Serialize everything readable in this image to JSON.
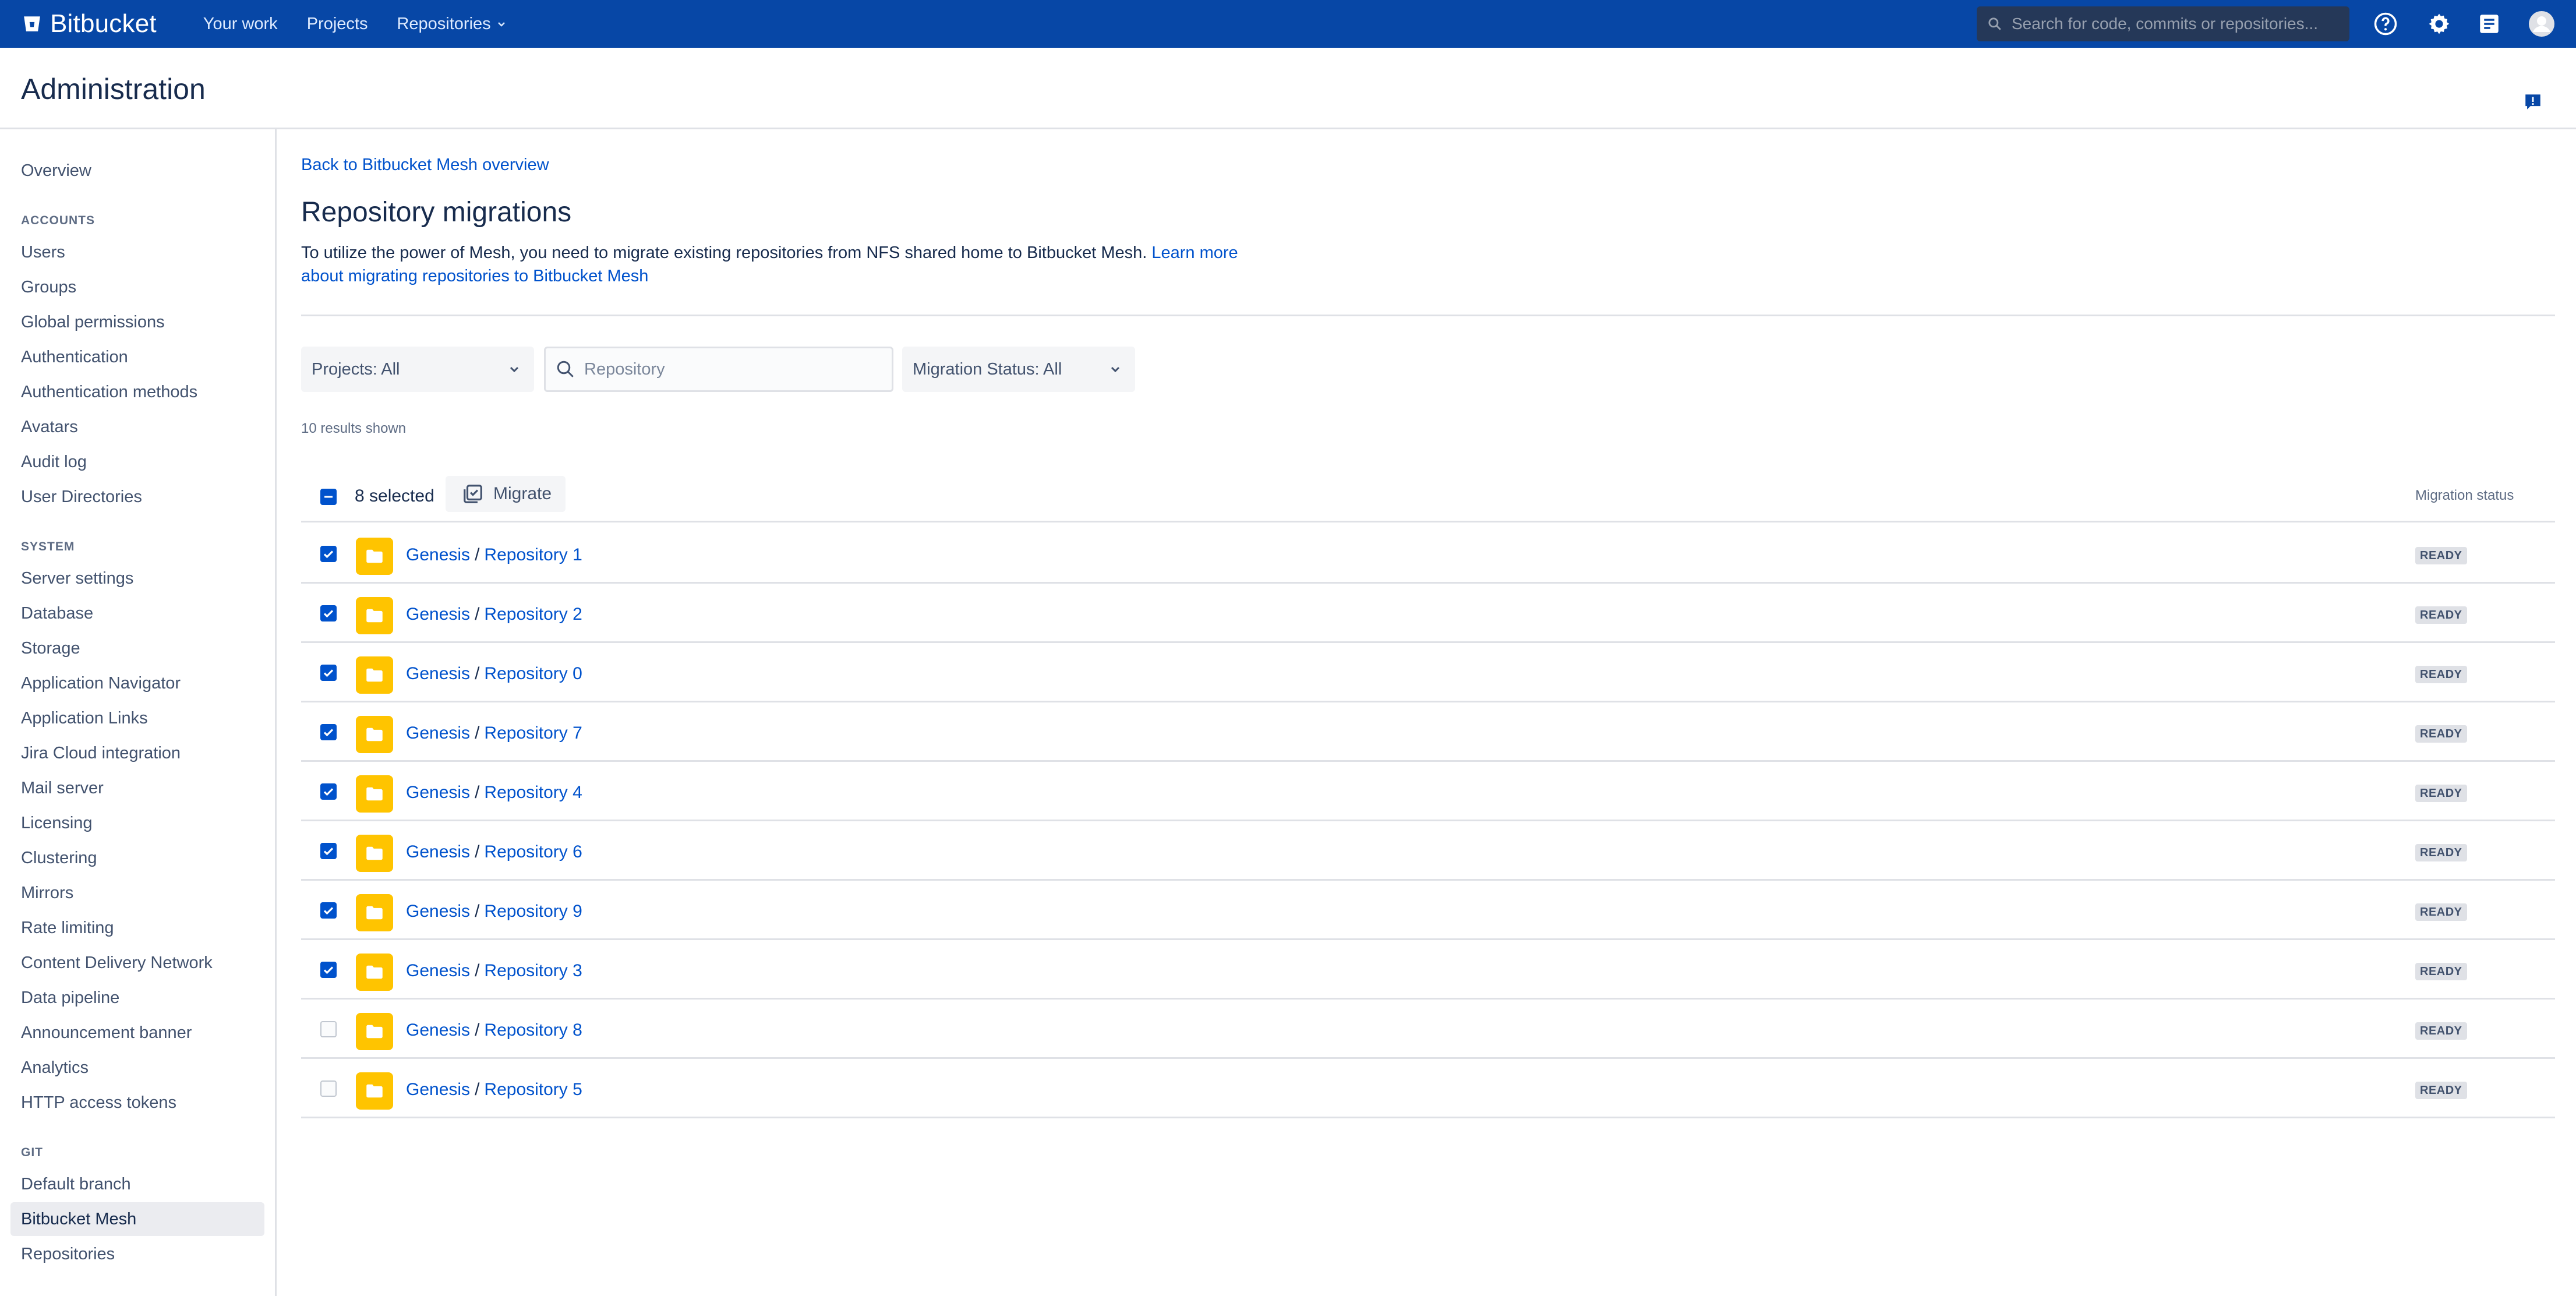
{
  "topbar": {
    "brand": "Bitbucket",
    "nav": [
      "Your work",
      "Projects",
      "Repositories"
    ],
    "search_placeholder": "Search for code, commits or repositories...",
    "icons": [
      "help-icon",
      "settings-icon",
      "notes-icon",
      "user-avatar"
    ],
    "colors": {
      "bar": "#0747a6",
      "search_bg": "#253858"
    }
  },
  "page": {
    "title": "Administration"
  },
  "sidebar": {
    "top": [
      {
        "label": "Overview"
      }
    ],
    "sections": [
      {
        "heading": "ACCOUNTS",
        "items": [
          "Users",
          "Groups",
          "Global permissions",
          "Authentication",
          "Authentication methods",
          "Avatars",
          "Audit log",
          "User Directories"
        ]
      },
      {
        "heading": "SYSTEM",
        "items": [
          "Server settings",
          "Database",
          "Storage",
          "Application Navigator",
          "Application Links",
          "Jira Cloud integration",
          "Mail server",
          "Licensing",
          "Clustering",
          "Mirrors",
          "Rate limiting",
          "Content Delivery Network",
          "Data pipeline",
          "Announcement banner",
          "Analytics",
          "HTTP access tokens"
        ]
      },
      {
        "heading": "GIT",
        "items": [
          "Default branch",
          "Bitbucket Mesh",
          "Repositories"
        ]
      }
    ],
    "active": "Bitbucket Mesh"
  },
  "main": {
    "back_link": "Back to Bitbucket Mesh overview",
    "heading": "Repository migrations",
    "intro_text": "To utilize the power of Mesh, you need to migrate existing repositories from NFS shared home to Bitbucket Mesh. ",
    "intro_link": "Learn more about migrating repositories to Bitbucket Mesh",
    "filters": {
      "projects": "Projects: All",
      "repository_placeholder": "Repository",
      "migration_status": "Migration Status: All"
    },
    "results_text": "10 results shown",
    "table": {
      "selected_label": "8 selected",
      "migrate_label": "Migrate",
      "status_header": "Migration status",
      "rows": [
        {
          "project": "Genesis",
          "repo": "Repository 1",
          "checked": true,
          "status": "READY"
        },
        {
          "project": "Genesis",
          "repo": "Repository 2",
          "checked": true,
          "status": "READY"
        },
        {
          "project": "Genesis",
          "repo": "Repository 0",
          "checked": true,
          "status": "READY"
        },
        {
          "project": "Genesis",
          "repo": "Repository 7",
          "checked": true,
          "status": "READY"
        },
        {
          "project": "Genesis",
          "repo": "Repository 4",
          "checked": true,
          "status": "READY"
        },
        {
          "project": "Genesis",
          "repo": "Repository 6",
          "checked": true,
          "status": "READY"
        },
        {
          "project": "Genesis",
          "repo": "Repository 9",
          "checked": true,
          "status": "READY"
        },
        {
          "project": "Genesis",
          "repo": "Repository 3",
          "checked": true,
          "status": "READY"
        },
        {
          "project": "Genesis",
          "repo": "Repository 8",
          "checked": false,
          "status": "READY"
        },
        {
          "project": "Genesis",
          "repo": "Repository 5",
          "checked": false,
          "status": "READY"
        }
      ]
    },
    "colors": {
      "link": "#0052cc",
      "checkbox": "#0052cc",
      "repo_avatar": "#ffc400"
    }
  }
}
